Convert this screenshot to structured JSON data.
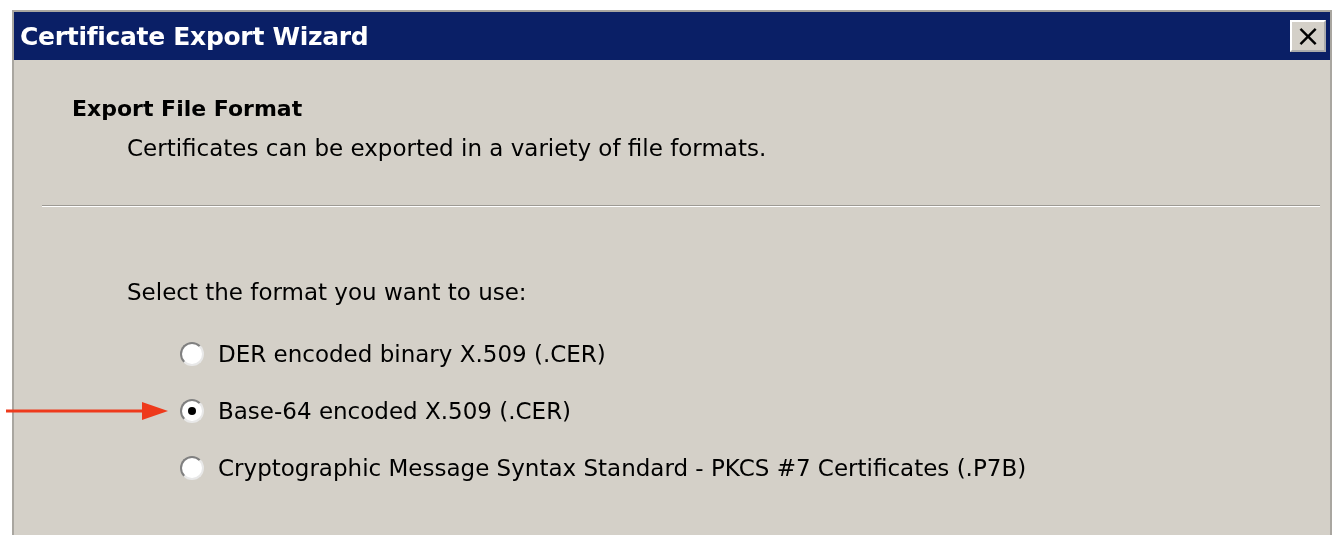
{
  "window": {
    "title": "Certificate Export Wizard",
    "close_label": "×"
  },
  "header": {
    "title": "Export File Format",
    "subtitle": "Certificates can be exported in a variety of file formats."
  },
  "prompt": "Select the format you want to use:",
  "options": [
    {
      "label": "DER encoded binary X.509 (.CER)",
      "selected": false,
      "annotated": false
    },
    {
      "label": "Base-64 encoded X.509 (.CER)",
      "selected": true,
      "annotated": true
    },
    {
      "label": "Cryptographic Message Syntax Standard - PKCS #7 Certificates (.P7B)",
      "selected": false,
      "annotated": false
    }
  ]
}
